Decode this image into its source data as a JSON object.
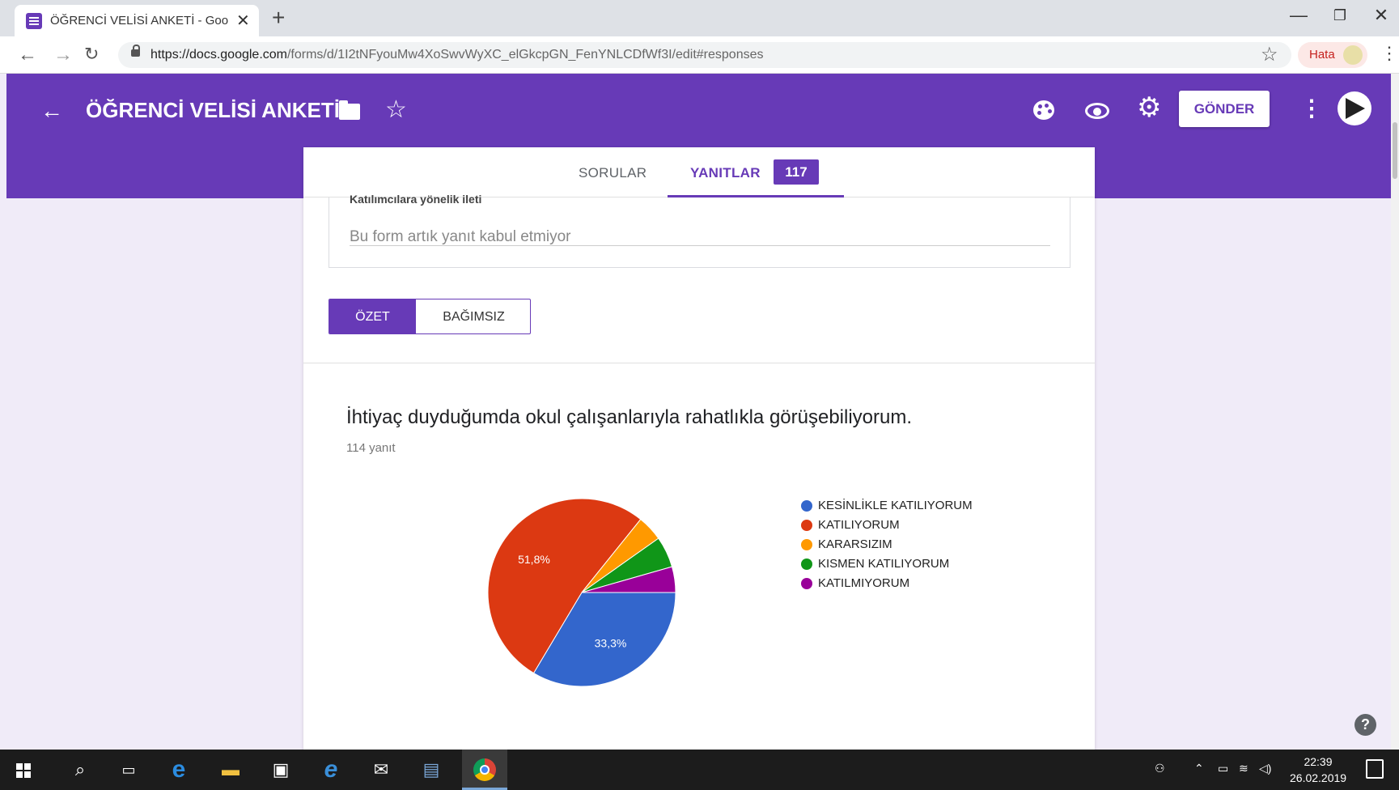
{
  "browser": {
    "tab_title": "ÖĞRENCİ VELİSİ ANKETİ - Google",
    "url_host": "https://docs.google.com",
    "url_path": "/forms/d/1I2tNFyouMw4XoSwvWyXC_elGkcpGN_FenYNLCDfWf3I/edit#responses",
    "error_pill": "Hata"
  },
  "header": {
    "form_title": "ÖĞRENCİ VELİSİ ANKETİ",
    "send_label": "GÖNDER",
    "color": "#673ab7"
  },
  "tabs": {
    "questions": "SORULAR",
    "responses": "YANITLAR",
    "responses_count": "117"
  },
  "message": {
    "label": "Katılımcılara yönelik ileti",
    "value": "Bu form artık yanıt kabul etmiyor"
  },
  "view_toggle": {
    "summary": "ÖZET",
    "individual": "BAĞIMSIZ"
  },
  "question": {
    "title": "İhtiyaç duyduğumda okul çalışanlarıyla rahatlıkla görüşebiliyorum.",
    "response_count": "114 yanıt"
  },
  "chart_data": {
    "type": "pie",
    "labels": [
      "KESİNLİKLE KATILIYORUM",
      "KATILIYORUM",
      "KARARSIZIM",
      "KISMEN KATILIYORUM",
      "KATILMIYORUM"
    ],
    "values": [
      33.3,
      51.8,
      4.4,
      5.3,
      4.4
    ],
    "colors": [
      "#3366cc",
      "#dc3912",
      "#ff9900",
      "#109618",
      "#990099"
    ],
    "data_labels": [
      "33,3%",
      "51,8%",
      "",
      "",
      ""
    ],
    "legend_position": "right"
  },
  "taskbar": {
    "time": "22:39",
    "date": "26.02.2019"
  }
}
